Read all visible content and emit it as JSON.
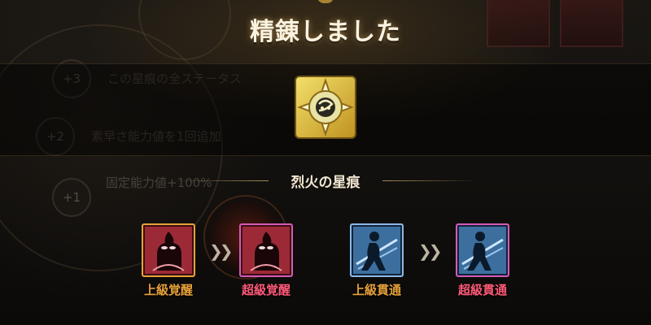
{
  "title": "精錬しました",
  "background": {
    "rows": [
      {
        "badge": "+3",
        "text": "この星痕の全ステータス"
      },
      {
        "badge": "+2",
        "text": "素早さ能力値を1回追加"
      },
      {
        "badge": "+1",
        "text": "固定能力値+100%"
      }
    ]
  },
  "item": {
    "name": "烈火の星痕",
    "icon": "star-mark-emblem-icon"
  },
  "upgrades": [
    {
      "from": "上級覚醒",
      "to": "超級覚醒",
      "icon": "awakening-silhouette-icon"
    },
    {
      "from": "上級貫通",
      "to": "超級貫通",
      "icon": "pierce-silhouette-icon"
    }
  ],
  "colors": {
    "from_label": "#e8a23a",
    "to_label": "#ff5a78",
    "title_text": "#fbf3e1",
    "awaken_from_frame": "#e8a23a",
    "awaken_to_frame": "#d65ab8",
    "pierce_from_frame": "#8fb8e8",
    "pierce_to_frame": "#d65ab8"
  }
}
